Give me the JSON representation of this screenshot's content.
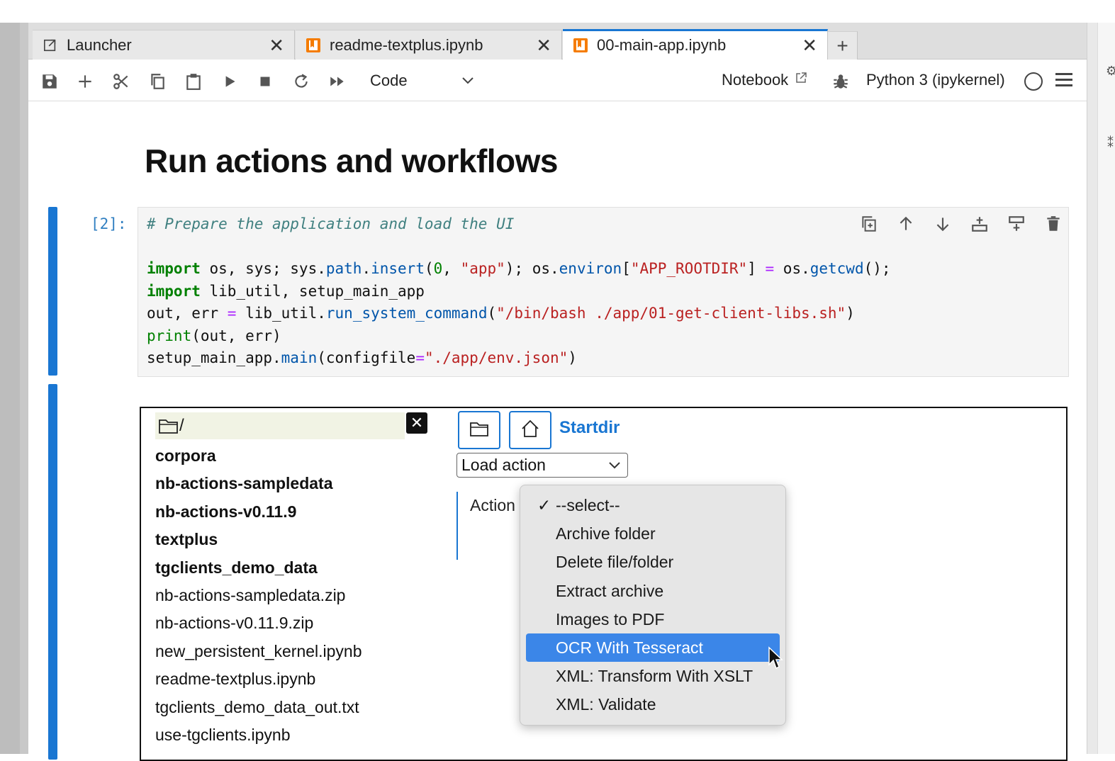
{
  "tabs": [
    {
      "label": "Launcher",
      "icon": "launcher-icon",
      "close": "✕",
      "active": false
    },
    {
      "label": "readme-textplus.ipynb",
      "icon": "notebook-icon",
      "close": "✕",
      "active": false
    },
    {
      "label": "00-main-app.ipynb",
      "icon": "notebook-icon",
      "close": "✕",
      "active": true
    }
  ],
  "new_tab_label": "+",
  "toolbar": {
    "cell_type": "Code",
    "notebook_label": "Notebook",
    "kernel_name": "Python 3 (ipykernel)"
  },
  "heading": "Run actions and workflows",
  "code_cell": {
    "prompt": "[2]:",
    "comment": "# Prepare the application and load the UI"
  },
  "widget": {
    "path": "/",
    "startdir_label": "Startdir",
    "load_action_selected": "Load action",
    "action_label": "Action",
    "files": [
      {
        "name": "corpora",
        "dir": true
      },
      {
        "name": "nb-actions-sampledata",
        "dir": true
      },
      {
        "name": "nb-actions-v0.11.9",
        "dir": true
      },
      {
        "name": "textplus",
        "dir": true
      },
      {
        "name": "tgclients_demo_data",
        "dir": true
      },
      {
        "name": "nb-actions-sampledata.zip",
        "dir": false
      },
      {
        "name": "nb-actions-v0.11.9.zip",
        "dir": false
      },
      {
        "name": "new_persistent_kernel.ipynb",
        "dir": false
      },
      {
        "name": "readme-textplus.ipynb",
        "dir": false
      },
      {
        "name": "tgclients_demo_data_out.txt",
        "dir": false
      },
      {
        "name": "use-tgclients.ipynb",
        "dir": false
      }
    ],
    "dropdown": {
      "checked_mark": "✓",
      "options": [
        "--select--",
        "Archive folder",
        "Delete file/folder",
        "Extract archive",
        "Images to PDF",
        "OCR With Tesseract",
        "XML: Transform With XSLT",
        "XML: Validate"
      ],
      "checked_index": 0,
      "highlighted_index": 5
    }
  },
  "colors": {
    "accent": "#1976d2",
    "highlight": "#3b86e8"
  }
}
